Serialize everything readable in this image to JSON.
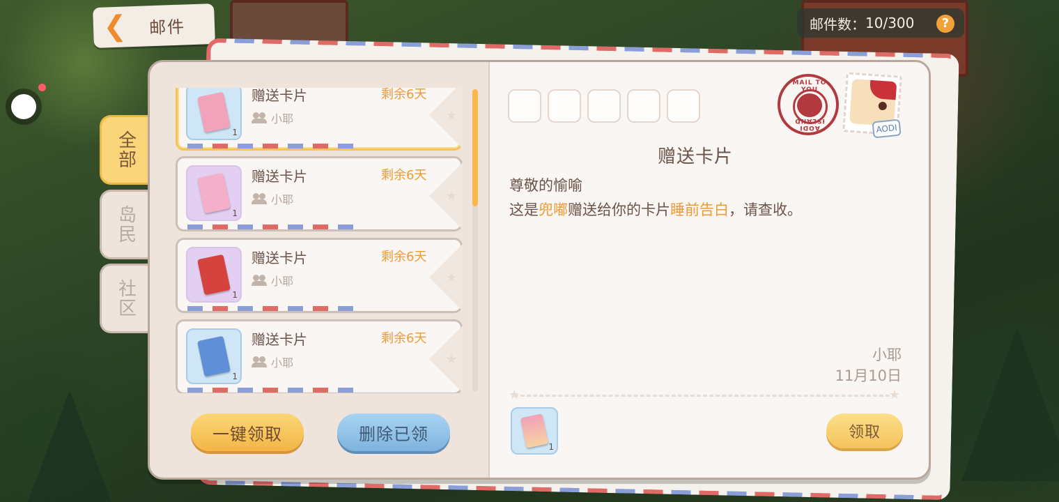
{
  "header": {
    "back_label": "邮件",
    "mail_count_label": "邮件数：",
    "mail_count_value": "10/300",
    "help_glyph": "?"
  },
  "tabs": [
    {
      "label": "全部",
      "active": true
    },
    {
      "label": "岛民",
      "active": false
    },
    {
      "label": "社区",
      "active": false
    }
  ],
  "mail_list": [
    {
      "title": "赠送卡片",
      "remaining": "剩余6天",
      "sender": "小耶",
      "qty": "1",
      "thumb_color": "#cfe6f7",
      "card_color": "#f0a3bb",
      "selected": true
    },
    {
      "title": "赠送卡片",
      "remaining": "剩余6天",
      "sender": "小耶",
      "qty": "1",
      "thumb_color": "#e3cff1",
      "card_color": "#f3b0c8",
      "selected": false
    },
    {
      "title": "赠送卡片",
      "remaining": "剩余6天",
      "sender": "小耶",
      "qty": "1",
      "thumb_color": "#e3cff1",
      "card_color": "#d5433e",
      "selected": false
    },
    {
      "title": "赠送卡片",
      "remaining": "剩余6天",
      "sender": "小耶",
      "qty": "1",
      "thumb_color": "#cfe6f7",
      "card_color": "#5f8fd6",
      "selected": false
    }
  ],
  "buttons": {
    "claim_all": "一键领取",
    "delete_claimed": "删除已领",
    "claim": "领取"
  },
  "detail": {
    "title": "赠送卡片",
    "greeting": "尊敬的愉喻",
    "body_prefix": "这是",
    "body_sender": "兜嘟",
    "body_middle": "赠送给你的卡片",
    "body_card": "睡前告白",
    "body_suffix": "，请查收。",
    "signature_name": "小耶",
    "signature_date": "11月10日",
    "attachment_qty": "1"
  },
  "postmark": {
    "top_text": "MAIL TO YOU",
    "bottom_text": "AODI ISLAND"
  },
  "stamp": {
    "plane_text": "AODI"
  },
  "colors": {
    "accent_orange": "#ee9a37",
    "active_tab": "#fbd579",
    "delete_button": "#7fb4de",
    "postmark_red": "#b23a3e"
  }
}
